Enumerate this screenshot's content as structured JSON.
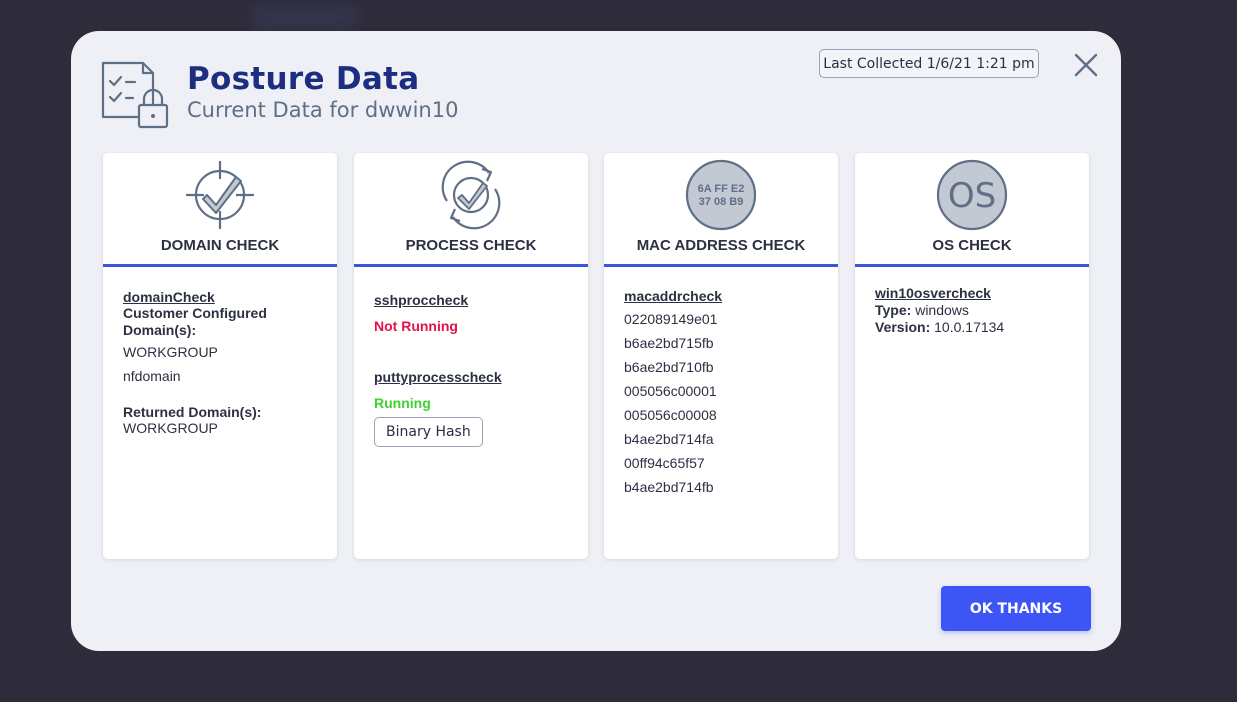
{
  "header": {
    "title": "Posture Data",
    "subtitle": "Current Data for dwwin10",
    "last_collected": "Last Collected 1/6/21 1:21 pm"
  },
  "cards": {
    "domain": {
      "title": "DOMAIN CHECK",
      "check_name": "domainCheck",
      "configured_label": "Customer Configured Domain(s):",
      "configured": [
        "WORKGROUP",
        "nfdomain"
      ],
      "returned_label": "Returned Domain(s):",
      "returned": "WORKGROUP"
    },
    "process": {
      "title": "PROCESS CHECK",
      "items": [
        {
          "name": "sshproccheck",
          "status": "Not Running"
        },
        {
          "name": "puttyprocesscheck",
          "status": "Running"
        }
      ],
      "hash_button": "Binary Hash"
    },
    "mac": {
      "title": "MAC ADDRESS CHECK",
      "icon_line1": "6A FF E2",
      "icon_line2": "37 08 B9",
      "check_name": "macaddrcheck",
      "addresses": [
        "022089149e01",
        "b6ae2bd715fb",
        "b6ae2bd710fb",
        "005056c00001",
        "005056c00008",
        "b4ae2bd714fa",
        "00ff94c65f57",
        "b4ae2bd714fb"
      ]
    },
    "os": {
      "title": "OS CHECK",
      "icon_text": "OS",
      "check_name": "win10osvercheck",
      "type_label": "Type:",
      "type_value": "windows",
      "version_label": "Version:",
      "version_value": "10.0.17134"
    }
  },
  "footer": {
    "ok_label": "OK THANKS"
  },
  "colors": {
    "accent": "#3b55dc",
    "title": "#1d2e80",
    "not_running": "#e2134b",
    "running": "#3ed12f",
    "button": "#3d55f5"
  }
}
